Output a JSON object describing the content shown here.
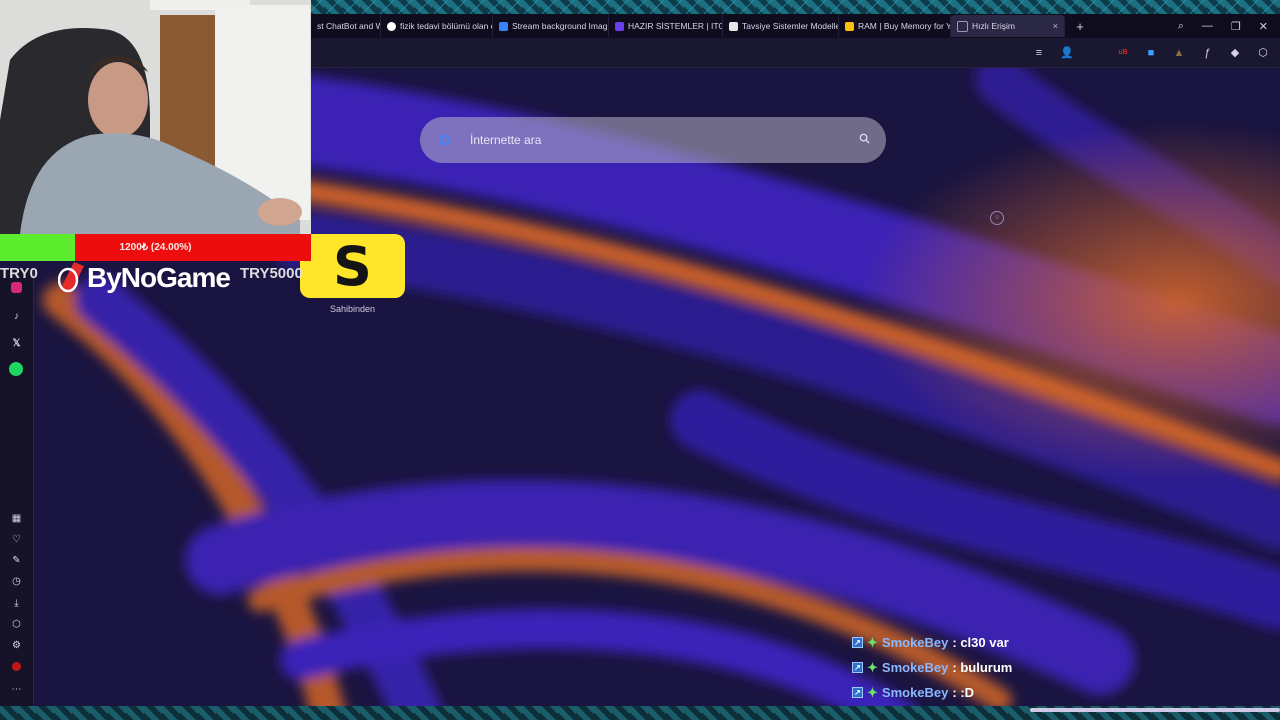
{
  "browser": {
    "tabs": [
      {
        "label": "st ChatBot and Wi",
        "favicon_color": "#0f0d1d",
        "active": false
      },
      {
        "label": "fizik tedavi bölümü olan d",
        "favicon_color": "#4285f4",
        "active": false
      },
      {
        "label": "Stream background Imag",
        "favicon_color": "#3b82f6",
        "active": false
      },
      {
        "label": "HAZIR SİSTEMLER | ITOPY",
        "favicon_color": "#6b3ff0",
        "active": false
      },
      {
        "label": "Tavsiye Sistemler Modelle",
        "favicon_color": "#2a2a2a",
        "active": false
      },
      {
        "label": "RAM | Buy Memory for Yo",
        "favicon_color": "#ffc107",
        "active": false
      },
      {
        "label": "Hızlı Erişim",
        "favicon_color": "#9b97b8",
        "active": true,
        "close": "×"
      }
    ],
    "new_tab": "+",
    "window_controls": [
      "⌕",
      "—",
      "❐",
      "✕"
    ],
    "toolbar_icons": [
      "≡",
      "👤",
      "uB",
      "■",
      "▲",
      "ƒ",
      "◆",
      "⬡"
    ]
  },
  "search": {
    "logo": "G",
    "placeholder": "İnternette ara",
    "icon": "search-icon"
  },
  "speed_dial": {
    "tile_letter": "S",
    "tile_label": "Sahibinden",
    "tile_color": "#ffe62a"
  },
  "sidebar_icons": [
    "instagram-icon",
    "tiktok-icon",
    "x-icon",
    "spotify-icon",
    "grid-icon",
    "heart-icon",
    "edit-icon",
    "history-icon",
    "download-icon",
    "box-icon",
    "settings-icon",
    "ublock-icon",
    "more-icon"
  ],
  "overlay": {
    "donation_text": "1200₺ (24.00%)",
    "donation_progress": 0.24,
    "try_left": "TRY0",
    "try_right": "TRY5000",
    "sponsor": "ByNoGame"
  },
  "chat": [
    {
      "user": "SmokeBey",
      "text": " : cl30 var"
    },
    {
      "user": "SmokeBey",
      "text": " : bulurum"
    },
    {
      "user": "SmokeBey",
      "text": " : :D"
    }
  ],
  "colors": {
    "wallpaper_base": "#140f2e",
    "wallpaper_purple": "#3a1fa0",
    "wallpaper_orange": "#c8602c",
    "donation_fill": "#5ced2e",
    "donation_bg": "#ee0d0d"
  }
}
